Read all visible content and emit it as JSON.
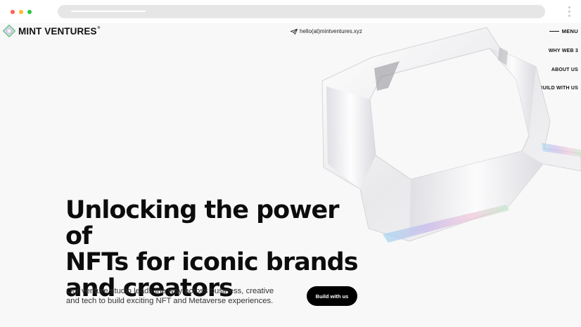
{
  "logo": {
    "text": "MINT VENTURES",
    "reg": "®"
  },
  "header": {
    "email": "hello(at)mintventures.xyz",
    "menu_label": "MENU"
  },
  "nav": {
    "items": [
      {
        "label": "WHY WEB 3"
      },
      {
        "label": "ABOUT US"
      },
      {
        "label": "BUILD WITH US"
      }
    ]
  },
  "hero": {
    "headline_lines": [
      "Unlocking the power of",
      "NFTs for iconic brands",
      "and creators"
    ],
    "subtext": "Our venture studio leads the way across business, creative and tech to build exciting NFT and Metaverse experiences.",
    "cta_label": "Build with us"
  },
  "colors": {
    "cta_bg": "#000000",
    "background": "#f8f8f8",
    "logo_green": "#7ecb9a"
  },
  "icons": {
    "email": "paper-plane-icon",
    "logo": "mint-logo-icon",
    "menu": "menu-line-icon"
  }
}
